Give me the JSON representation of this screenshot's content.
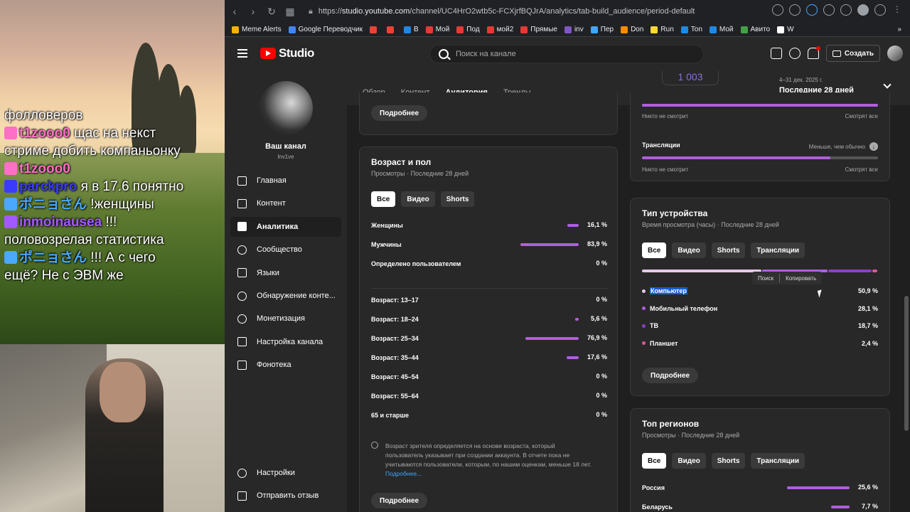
{
  "stream": {
    "chat": [
      {
        "user": "",
        "user_color": "#ffffff",
        "text": "фолловеров"
      },
      {
        "user": "t1zooo0",
        "user_color": "#ff6ec7",
        "text": "щас на некст"
      },
      {
        "user": "",
        "user_color": "#ffffff",
        "text": "стриме добить компаньонку"
      },
      {
        "user": "t1zooo0",
        "user_color": "#ff6ec7",
        "text": ""
      },
      {
        "user": "parckpro",
        "user_color": "#3b3bff",
        "text": "я в 17.6 понятно"
      },
      {
        "user": "ポニョさん",
        "user_color": "#4aa8ff",
        "text": "!женщины"
      },
      {
        "user": "inmoinausea",
        "user_color": "#a259ff",
        "text": "!!!"
      },
      {
        "user": "",
        "user_color": "#ffffff",
        "text": "половозрелая статистика"
      },
      {
        "user": "ポニョさん",
        "user_color": "#4aa8ff",
        "text": "!!! А с чего"
      },
      {
        "user": "",
        "user_color": "#ffffff",
        "text": "ещё? Не с ЭВМ же"
      }
    ]
  },
  "browser": {
    "url_prefix": "https://",
    "url_host": "studio.youtube.com",
    "url_path": "/channel/UC4HrO2wtb5c-FCXjrfBQJrA/analytics/tab-build_audience/period-default",
    "bookmarks": [
      {
        "label": "Meme Alerts",
        "color": "#f4b400"
      },
      {
        "label": "Google Переводчик",
        "color": "#4285f4"
      },
      {
        "label": "",
        "color": "#ea4335"
      },
      {
        "label": "",
        "color": "#ea4335"
      },
      {
        "label": "В",
        "color": "#1e88e5"
      },
      {
        "label": "Мой",
        "color": "#e53935"
      },
      {
        "label": "Под",
        "color": "#e53935"
      },
      {
        "label": "мой2",
        "color": "#e53935"
      },
      {
        "label": "Прямые",
        "color": "#e53935"
      },
      {
        "label": "inv",
        "color": "#7e57c2"
      },
      {
        "label": "Пер",
        "color": "#42a5f5"
      },
      {
        "label": "Don",
        "color": "#fb8c00"
      },
      {
        "label": "Run",
        "color": "#fdd835"
      },
      {
        "label": "Ton",
        "color": "#1e88e5"
      },
      {
        "label": "Мой",
        "color": "#1e88e5"
      },
      {
        "label": "Авито",
        "color": "#43a047"
      },
      {
        "label": "W",
        "color": "#ffffff"
      }
    ]
  },
  "header": {
    "logo": "Studio",
    "search_placeholder": "Поиск на канале",
    "create_label": "Создать"
  },
  "sidebar": {
    "channel_label": "Ваш канал",
    "channel_handle": "lnv1ve",
    "items": [
      {
        "label": "Главная",
        "icon": "dashboard-icon"
      },
      {
        "label": "Контент",
        "icon": "content-icon"
      },
      {
        "label": "Аналитика",
        "icon": "analytics-icon"
      },
      {
        "label": "Сообщество",
        "icon": "community-icon"
      },
      {
        "label": "Языки",
        "icon": "subtitles-icon"
      },
      {
        "label": "Обнаружение конте...",
        "icon": "copyright-icon"
      },
      {
        "label": "Монетизация",
        "icon": "monetization-icon"
      },
      {
        "label": "Настройка канала",
        "icon": "customization-icon"
      },
      {
        "label": "Фонотека",
        "icon": "audio-library-icon"
      }
    ],
    "bottom_items": [
      {
        "label": "Настройки",
        "icon": "settings-icon"
      },
      {
        "label": "Отправить отзыв",
        "icon": "feedback-icon"
      }
    ]
  },
  "tabs": [
    "Обзор",
    "Контент",
    "Аудитория",
    "Тренды"
  ],
  "active_tab": "Аудитория",
  "period": {
    "range": "4–31 дек. 2025 г.",
    "label": "Последние 28 дней"
  },
  "partial_number": "1 003",
  "top_card": {
    "more_label": "Подробнее"
  },
  "age_gender": {
    "title": "Возраст и пол",
    "subtitle": "Просмотры · Последние 28 дней",
    "chips": [
      "Все",
      "Видео",
      "Shorts"
    ],
    "gender_rows": [
      {
        "label": "Женщины",
        "value": "16,1 %",
        "pct": 16.1
      },
      {
        "label": "Мужчины",
        "value": "83,9 %",
        "pct": 83.9
      },
      {
        "label": "Определено пользователем",
        "value": "0 %",
        "pct": 0
      }
    ],
    "age_rows": [
      {
        "label": "Возраст: 13–17",
        "value": "0 %",
        "pct": 0
      },
      {
        "label": "Возраст: 18–24",
        "value": "5,6 %",
        "pct": 5.6
      },
      {
        "label": "Возраст: 25–34",
        "value": "76,9 %",
        "pct": 76.9
      },
      {
        "label": "Возраст: 35–44",
        "value": "17,6 %",
        "pct": 17.6
      },
      {
        "label": "Возраст: 45–54",
        "value": "0 %",
        "pct": 0
      },
      {
        "label": "Возраст: 55–64",
        "value": "0 %",
        "pct": 0
      },
      {
        "label": "65 и старше",
        "value": "0 %",
        "pct": 0
      }
    ],
    "note": "Возраст зрителя определяется на основе возраста, который пользователь указывает при создании аккаунта. В отчете пока не учитываются пользователи, которым, по нашим оценкам, меньше 18 лет.",
    "note_link": "Подробнее...",
    "more_label": "Подробнее"
  },
  "watch_card": {
    "row1_left": "Никто не смотрит",
    "row1_right": "Смотрят все",
    "streams_title": "Трансляции",
    "streams_status": "Меньше, чем обычно",
    "row2_left": "Никто не смотрит",
    "row2_right": "Смотрят все"
  },
  "device_card": {
    "title": "Тип устройства",
    "subtitle": "Время просмотра (часы) · Последние 28 дней",
    "chips": [
      "Все",
      "Видео",
      "Shorts",
      "Трансляции"
    ],
    "context_menu": [
      "Поиск",
      "Копировать"
    ],
    "rows": [
      {
        "label": "Компьютер",
        "value": "50,9 %",
        "color": "#e8c8ec"
      },
      {
        "label": "Мобильный телефон",
        "value": "28,1 %",
        "color": "#b05ee0"
      },
      {
        "label": "ТВ",
        "value": "18,7 %",
        "color": "#8e3fc4"
      },
      {
        "label": "Планшет",
        "value": "2,4 %",
        "color": "#e0529a"
      }
    ],
    "more_label": "Подробнее"
  },
  "regions_card": {
    "title": "Топ регионов",
    "subtitle": "Просмотры · Последние 28 дней",
    "chips": [
      "Все",
      "Видео",
      "Shorts",
      "Трансляции"
    ],
    "rows": [
      {
        "label": "Россия",
        "value": "25,6 %",
        "pct": 25.6
      },
      {
        "label": "Беларусь",
        "value": "7,7 %",
        "pct": 7.7
      }
    ]
  }
}
